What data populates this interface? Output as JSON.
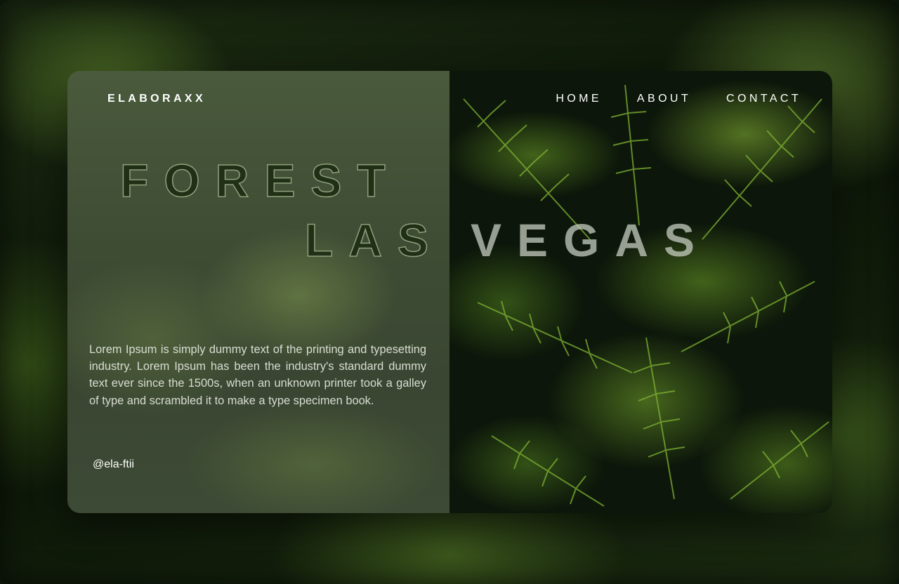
{
  "brand": "ELABORAXX",
  "nav": {
    "home": "HOME",
    "about": "ABOUT",
    "contact": "CONTACT"
  },
  "hero": {
    "line1": "FOREST",
    "line2a": "LAS",
    "line2b": "VEGAS"
  },
  "description": "Lorem Ipsum is simply dummy text of the printing and typesetting industry. Lorem Ipsum has been the industry's standard dummy  text ever since the 1500s, when an unknown printer took a galley of  type and scrambled it to make a type specimen book.",
  "handle": "@ela-ftii",
  "colors": {
    "accent_green": "#8fbf3a",
    "text_light": "#ffffff",
    "glass_panel": "#3e4c34"
  }
}
